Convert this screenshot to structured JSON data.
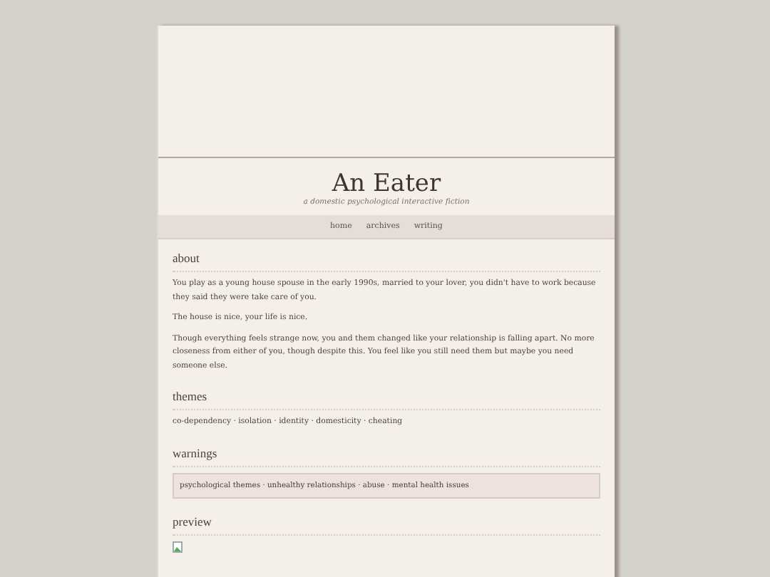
{
  "site": {
    "title": "An Eater",
    "subtitle": "a domestic psychological interactive fiction"
  },
  "nav": [
    "home",
    "archives",
    "writing"
  ],
  "about": {
    "heading": "about",
    "paragraphs": [
      "You play as a young house spouse in the early 1990s, married to your lover, you didn't have to work because they said they were take care of you.",
      "The house is nice, your life is nice.",
      "Though everything feels strange now, you and them changed like your relationship is falling apart. No more closeness from either of you, though despite this. You feel like you still need them but maybe you need someone else."
    ]
  },
  "themes": {
    "heading": "themes",
    "text": "co-dependency · isolation · identity · domesticity · cheating"
  },
  "warnings": {
    "heading": "warnings",
    "text": "psychological themes · unhealthy relationships · abuse · mental health issues"
  },
  "preview": {
    "heading": "preview"
  }
}
